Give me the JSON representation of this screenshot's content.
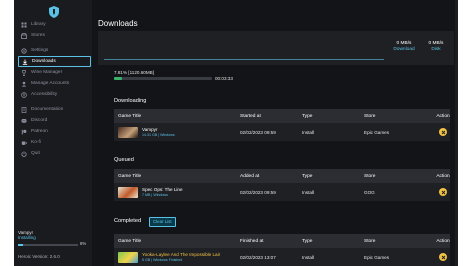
{
  "sidebar": {
    "items": [
      {
        "label": "Library",
        "icon": "library-icon"
      },
      {
        "label": "Stores",
        "icon": "store-icon"
      },
      {
        "label": "Settings",
        "icon": "gear-icon"
      },
      {
        "label": "Downloads",
        "icon": "download-icon"
      },
      {
        "label": "Wine Manager",
        "icon": "wine-icon"
      },
      {
        "label": "Manage Accounts",
        "icon": "user-icon"
      },
      {
        "label": "Accessibility",
        "icon": "accessibility-icon"
      },
      {
        "label": "Documentation",
        "icon": "book-icon"
      },
      {
        "label": "Discord",
        "icon": "discord-icon"
      },
      {
        "label": "Patreon",
        "icon": "patreon-icon"
      },
      {
        "label": "Ko-fi",
        "icon": "kofi-icon"
      },
      {
        "label": "Quit",
        "icon": "quit-icon"
      }
    ],
    "active": "Downloads",
    "current_download": {
      "title": "Vampyr",
      "status": "Installing",
      "percent": "8%",
      "progress": 0.08
    },
    "version": "Heroic Version: 2.6.0"
  },
  "main": {
    "title": "Downloads",
    "speed": {
      "download_value": "0 MB/s",
      "download_label": "Download",
      "disk_value": "0 MB/s",
      "disk_label": "Disk"
    },
    "progress": {
      "text": "7.81% [1120.60MB]",
      "fraction": 0.0781,
      "eta": "00:03:33"
    }
  },
  "downloading": {
    "heading": "Downloading",
    "headers": {
      "game": "Game Title",
      "date": "Started at",
      "type": "Type",
      "store": "Store",
      "action": "Action"
    },
    "rows": [
      {
        "title": "Vampyr",
        "size": "14.31 GB | Windows",
        "date": "02/02/2023 09:59",
        "type": "Install",
        "store": "Epic Games"
      }
    ]
  },
  "queued": {
    "heading": "Queued",
    "headers": {
      "game": "Game Title",
      "date": "Added at",
      "type": "Type",
      "store": "Store",
      "action": "Action"
    },
    "rows": [
      {
        "title": "Spec Ops: The Line",
        "size": "7 MB | Windows",
        "date": "02/02/2023 09:59",
        "type": "Install",
        "store": "GOG"
      }
    ]
  },
  "completed": {
    "heading": "Completed",
    "clear_label": "Clear List",
    "headers": {
      "game": "Game Title",
      "date": "Finished at",
      "type": "Type",
      "store": "Store",
      "action": "Action"
    },
    "rows": [
      {
        "title": "Yooka-Laylee And The Impossible Lair",
        "size": "5 GB | Windows Finished",
        "date": "02/02/2023 13:07",
        "type": "Install",
        "store": "Epic Games"
      }
    ]
  },
  "colors": {
    "accent": "#5bc2e7",
    "progress": "#38b16b",
    "action": "#f2c244",
    "background": "#131417"
  }
}
